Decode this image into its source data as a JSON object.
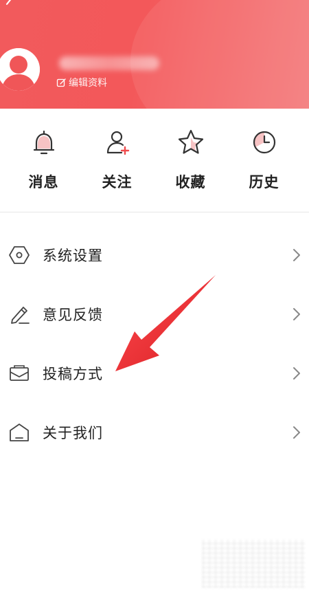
{
  "header": {
    "edit_profile_label": "编辑资料",
    "background_color": "#f25a5c"
  },
  "quick_actions": [
    {
      "label": "消息",
      "icon": "bell-icon"
    },
    {
      "label": "关注",
      "icon": "add-person-icon"
    },
    {
      "label": "收藏",
      "icon": "star-icon"
    },
    {
      "label": "历史",
      "icon": "clock-icon"
    }
  ],
  "menu": [
    {
      "label": "系统设置",
      "icon": "settings-hexagon-icon"
    },
    {
      "label": "意见反馈",
      "icon": "pencil-icon"
    },
    {
      "label": "投稿方式",
      "icon": "envelope-icon"
    },
    {
      "label": "关于我们",
      "icon": "home-outline-icon"
    }
  ],
  "colors": {
    "accent": "#f04b4d",
    "annotation_arrow": "#e8262b",
    "icon_stroke": "#333333",
    "chevron": "#888888"
  }
}
